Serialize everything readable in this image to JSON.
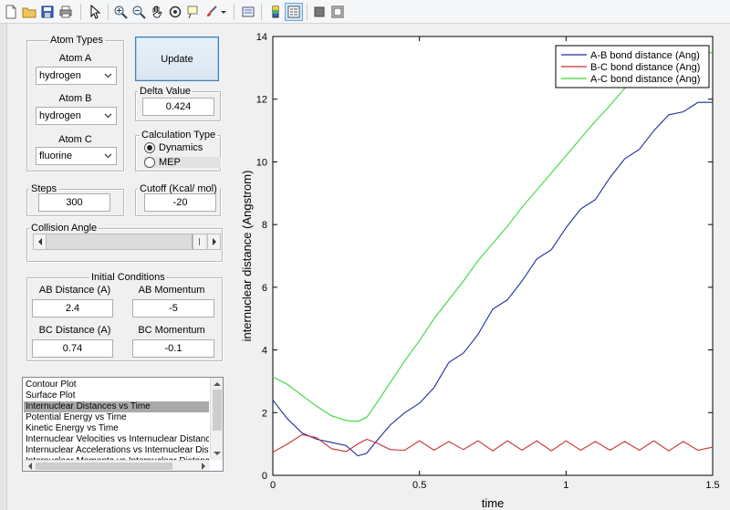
{
  "toolbar": {
    "icons": [
      "new-file-icon",
      "open-folder-icon",
      "save-icon",
      "print-icon",
      "pointer-icon",
      "zoom-in-icon",
      "zoom-out-icon",
      "pan-icon",
      "rotate-icon",
      "data-cursor-icon",
      "brush-icon",
      "link-plot-icon",
      "colorbar-icon",
      "legend-icon",
      "hide-tools-icon",
      "show-tools-icon"
    ]
  },
  "atom_types": {
    "legend": "Atom Types",
    "atom_a_label": "Atom A",
    "atom_a_value": "hydrogen",
    "atom_b_label": "Atom B",
    "atom_b_value": "hydrogen",
    "atom_c_label": "Atom C",
    "atom_c_value": "fluorine"
  },
  "update_button": "Update",
  "delta": {
    "legend": "Delta Value",
    "value": "0.424"
  },
  "calc_type": {
    "legend": "Calculation Type",
    "options": [
      "Dynamics",
      "MEP"
    ],
    "selected": "Dynamics"
  },
  "steps": {
    "legend": "Steps",
    "value": "300"
  },
  "cutoff": {
    "legend": "Cutoff (Kcal/ mol)",
    "value": "-20"
  },
  "collision_angle": {
    "legend": "Collision Angle"
  },
  "initial_conditions": {
    "legend": "Initial Conditions",
    "ab_distance_label": "AB Distance (A)",
    "ab_distance_value": "2.4",
    "ab_momentum_label": "AB Momentum",
    "ab_momentum_value": "-5",
    "bc_distance_label": "BC Distance (A)",
    "bc_distance_value": "0.74",
    "bc_momentum_label": "BC Momentum",
    "bc_momentum_value": "-0.1"
  },
  "plot_list": {
    "items": [
      "Contour Plot",
      "Surface Plot",
      "Internuclear Distances vs Time",
      "Potential Energy vs Time",
      "Kinetic Energy vs Time",
      "Internuclear Velocities vs Internuclear Distance",
      "Internuclear Accelerations vs Internuclear Distance",
      "Internuclear Momenta vs Internuclear Distance"
    ],
    "selected_index": 2
  },
  "chart_data": {
    "type": "line",
    "xlabel": "time",
    "ylabel": "internuclear distance (Angstrom)",
    "xlim": [
      0,
      1.5
    ],
    "ylim": [
      0,
      14
    ],
    "xticks": [
      0,
      0.5,
      1,
      1.5
    ],
    "xtick_labels": [
      "0",
      "0.5",
      "1",
      "1.5"
    ],
    "yticks": [
      0,
      2,
      4,
      6,
      8,
      10,
      12,
      14
    ],
    "ytick_labels": [
      "0",
      "2",
      "4",
      "6",
      "8",
      "10",
      "12",
      "14"
    ],
    "grid": false,
    "legend_position": "top-right",
    "x": [
      0,
      0.05,
      0.1,
      0.15,
      0.2,
      0.25,
      0.29,
      0.32,
      0.35,
      0.4,
      0.45,
      0.5,
      0.55,
      0.6,
      0.65,
      0.7,
      0.75,
      0.8,
      0.85,
      0.9,
      0.95,
      1.0,
      1.05,
      1.1,
      1.15,
      1.2,
      1.25,
      1.3,
      1.35,
      1.4,
      1.45,
      1.5
    ],
    "series": [
      {
        "name": "A-B bond distance (Ang)",
        "color": "#1f2f9e",
        "values": [
          2.4,
          1.8,
          1.35,
          1.15,
          1.05,
          0.95,
          0.62,
          0.7,
          1.05,
          1.6,
          2.0,
          2.3,
          2.8,
          3.6,
          3.9,
          4.5,
          5.3,
          5.6,
          6.2,
          6.9,
          7.2,
          7.9,
          8.5,
          8.8,
          9.5,
          10.1,
          10.4,
          11.0,
          11.5,
          11.6,
          11.9,
          11.9
        ]
      },
      {
        "name": "B-C bond distance (Ang)",
        "color": "#c83232",
        "values": [
          0.74,
          1.0,
          1.3,
          1.2,
          0.85,
          0.76,
          1.0,
          1.15,
          1.05,
          0.82,
          0.8,
          1.1,
          0.8,
          1.08,
          0.82,
          1.1,
          0.78,
          1.1,
          0.8,
          1.1,
          0.78,
          1.1,
          0.8,
          1.08,
          0.8,
          1.08,
          0.8,
          1.1,
          0.78,
          1.08,
          0.8,
          0.9
        ]
      },
      {
        "name": "A-C bond distance (Ang)",
        "color": "#3dd63d",
        "values": [
          3.14,
          2.9,
          2.55,
          2.2,
          1.9,
          1.75,
          1.72,
          1.85,
          2.25,
          2.95,
          3.65,
          4.3,
          5.0,
          5.6,
          6.2,
          6.85,
          7.4,
          7.95,
          8.55,
          9.1,
          9.65,
          10.2,
          10.75,
          11.3,
          11.8,
          12.35,
          12.85,
          12.95,
          13.1,
          13.25,
          13.4,
          13.5
        ]
      }
    ]
  }
}
